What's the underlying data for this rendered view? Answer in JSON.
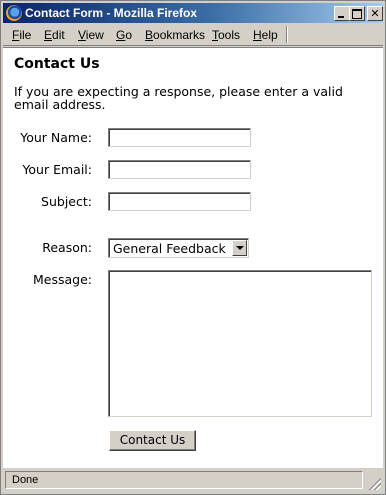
{
  "window": {
    "title": "Contact Form - Mozilla Firefox"
  },
  "menubar": {
    "items": [
      {
        "accel": "F",
        "rest": "ile"
      },
      {
        "accel": "E",
        "rest": "dit"
      },
      {
        "accel": "V",
        "rest": "iew"
      },
      {
        "accel": "G",
        "rest": "o"
      },
      {
        "accel": "B",
        "rest": "ookmarks"
      },
      {
        "accel": "T",
        "rest": "ools"
      },
      {
        "accel": "H",
        "rest": "elp"
      }
    ]
  },
  "page": {
    "title": "Contact Us",
    "intro": "If you are expecting a response, please enter a valid email address."
  },
  "form": {
    "name_label": "Your Name:",
    "name_value": "",
    "email_label": "Your Email:",
    "email_value": "",
    "subject_label": "Subject:",
    "subject_value": "",
    "reason_label": "Reason:",
    "reason_selected": "General Feedback",
    "message_label": "Message:",
    "message_value": "",
    "submit_label": "Contact Us"
  },
  "status": {
    "text": "Done"
  },
  "icons": {
    "app": "firefox-icon",
    "minimize": "minimize-icon",
    "maximize": "maximize-icon",
    "close": "close-icon",
    "dropdown": "chevron-down-icon",
    "resize": "resize-grip-icon"
  }
}
